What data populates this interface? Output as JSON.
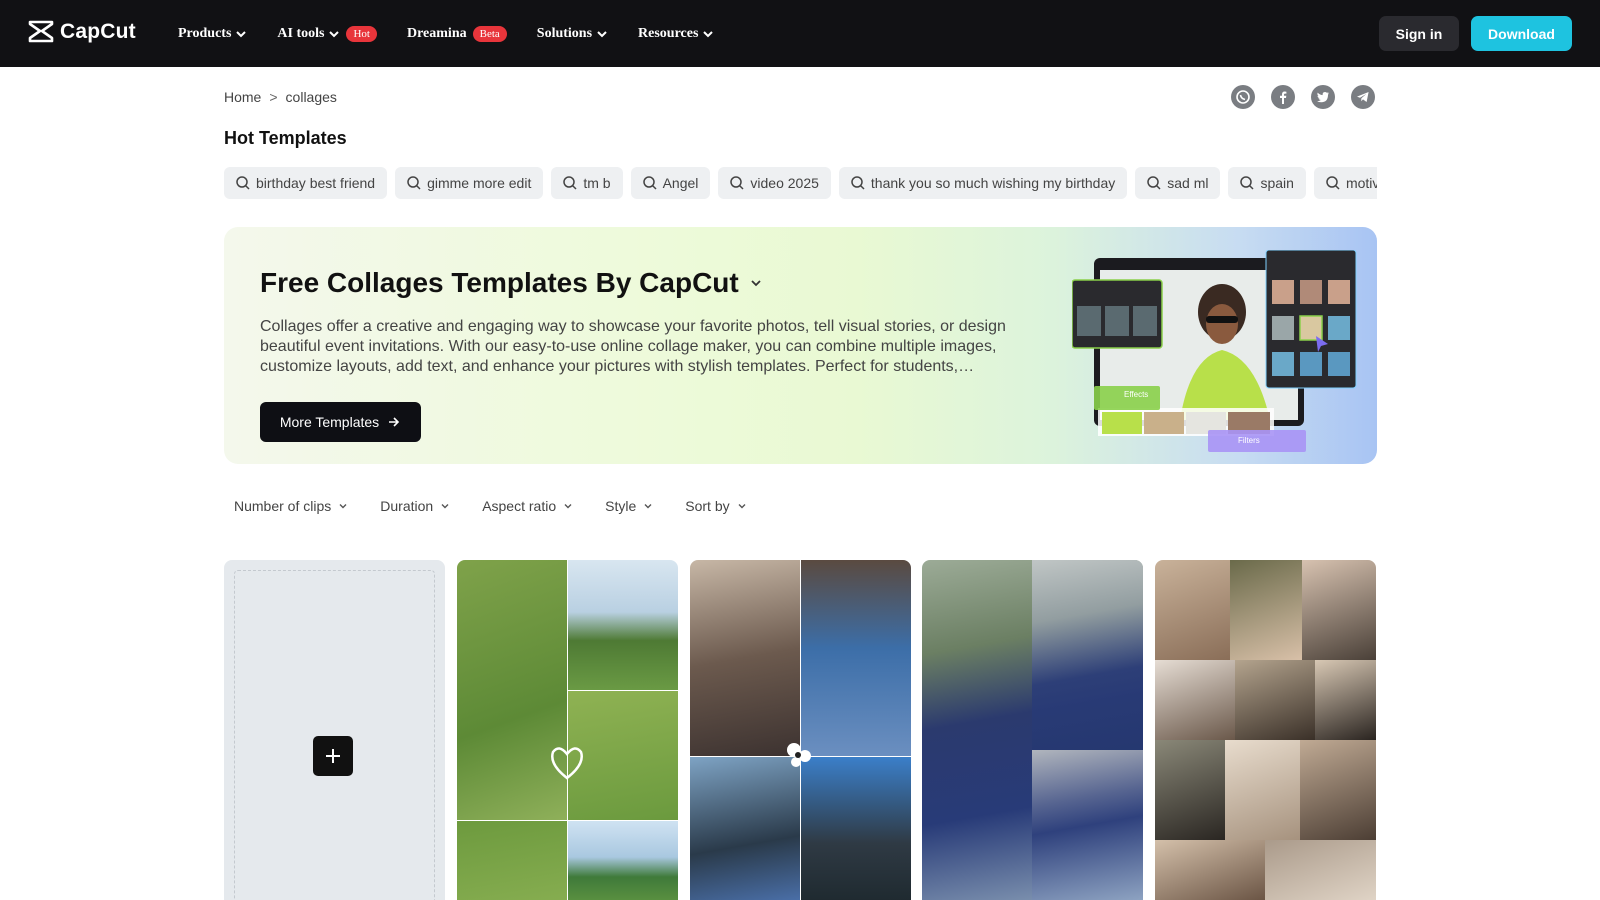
{
  "nav": {
    "logo": "CapCut",
    "menu": [
      {
        "label": "Products",
        "badge": null
      },
      {
        "label": "AI tools",
        "badge": "Hot"
      },
      {
        "label": "Dreamina",
        "badge": "Beta"
      },
      {
        "label": "Solutions",
        "badge": null
      },
      {
        "label": "Resources",
        "badge": null
      }
    ],
    "signin": "Sign in",
    "download": "Download"
  },
  "breadcrumb": {
    "home": "Home",
    "sep": ">",
    "current": "collages"
  },
  "share_icons": [
    "whatsapp-icon",
    "facebook-icon",
    "twitter-icon",
    "telegram-icon"
  ],
  "hot_templates": {
    "title": "Hot Templates",
    "chips": [
      "birthday best friend",
      "gimme more edit",
      "tm b",
      "Angel",
      "video 2025",
      "thank you so much wishing my birthday",
      "sad ml",
      "spain",
      "motivation"
    ]
  },
  "banner": {
    "title": "Free Collages Templates By CapCut",
    "description": "Collages offer a creative and engaging way to showcase your favorite photos, tell visual stories, or design beautiful event invitations. With our easy-to-use online collage maker, you can combine multiple images, customize layouts, add text, and enhance your pictures with stylish templates. Perfect for students,…",
    "button": "More Templates",
    "illus_effects": "Effects",
    "illus_filters": "Filters"
  },
  "filters": [
    "Number of clips",
    "Duration",
    "Aspect ratio",
    "Style",
    "Sort by"
  ],
  "colors": {
    "nav_bg": "#111114",
    "download": "#1ec3e0",
    "badge": "#e8353b"
  }
}
